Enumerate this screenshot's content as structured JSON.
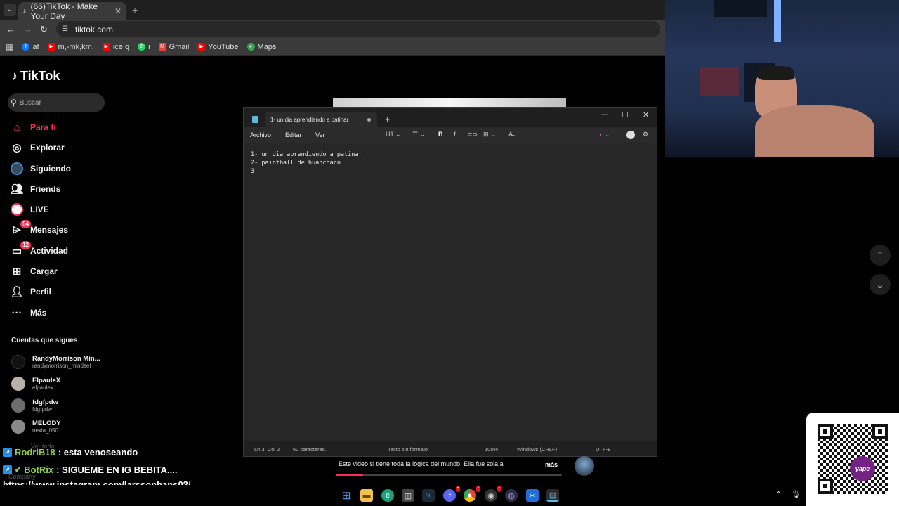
{
  "browser": {
    "tab_title": "(66)TikTok - Make Your Day",
    "url": "tiktok.com",
    "bookmarks": [
      {
        "label": "af",
        "color": "#1877f2"
      },
      {
        "label": "m,-mk,km.",
        "color": "#ff0000"
      },
      {
        "label": "ice q",
        "color": "#ff0000"
      },
      {
        "label": "i",
        "color": "#25d366"
      },
      {
        "label": "Gmail",
        "color": "#ea4335"
      },
      {
        "label": "YouTube",
        "color": "#ff0000"
      },
      {
        "label": "Maps",
        "color": "#34a853"
      }
    ]
  },
  "tiktok": {
    "logo": "TikTok",
    "search_placeholder": "Buscar",
    "nav": [
      {
        "label": "Para ti",
        "icon": "home-icon",
        "active": true
      },
      {
        "label": "Explorar",
        "icon": "compass-icon"
      },
      {
        "label": "Siguiendo",
        "icon": "following-avatar-icon"
      },
      {
        "label": "Friends",
        "icon": "friends-icon"
      },
      {
        "label": "LIVE",
        "icon": "live-icon"
      },
      {
        "label": "Mensajes",
        "icon": "messages-icon",
        "badge": "54"
      },
      {
        "label": "Actividad",
        "icon": "activity-icon",
        "badge": "12"
      },
      {
        "label": "Cargar",
        "icon": "upload-icon"
      },
      {
        "label": "Perfil",
        "icon": "profile-icon"
      },
      {
        "label": "Más",
        "icon": "more-icon"
      }
    ],
    "following_heading": "Cuentas que sigues",
    "following": [
      {
        "name": "RandyMorrison Min...",
        "handle": "randymorrison_mindset"
      },
      {
        "name": "ElpauleX",
        "handle": "elpaulex"
      },
      {
        "name": "fdgfpdw",
        "handle": "fdgfpdw"
      },
      {
        "name": "MELODY",
        "handle": "nexia_050"
      }
    ],
    "faded_link": "Ver todo",
    "faded_company": "Company",
    "caption": "Este video si tiene toda la lógica del mundo. Ella fue sola al",
    "caption_more": "más",
    "progress": 0.12
  },
  "chat": [
    {
      "user": "RodriB18",
      "message": ": esta venoseando"
    },
    {
      "user": "BotRix",
      "message": ": SIGUEME EN IG BEBITA...."
    }
  ],
  "chat_url": "https://www.instagram.com/larssonhans02/",
  "notepad": {
    "tab_title": "1- un dia aprendiendo a patinar",
    "menu": [
      "Archivo",
      "Editar",
      "Ver"
    ],
    "heading_tool": "H1",
    "lines": [
      "1- un dia aprendiendo a patinar",
      "2- paintball de huanchaco",
      "3"
    ],
    "status": {
      "position": "Ln 3, Col 2",
      "chars": "60 caracteres.",
      "format": "Texto sin formato",
      "zoom": "100%",
      "line_endings": "Windows (CRLF)",
      "encoding": "UTF-8"
    }
  },
  "qr": {
    "brand": "yape"
  }
}
